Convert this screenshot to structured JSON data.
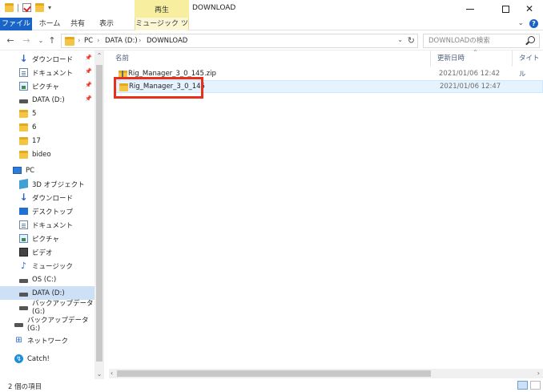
{
  "window": {
    "title": "DOWNLOAD",
    "contextual_group": "再生",
    "controls": {
      "minimize": "",
      "maximize": "",
      "close": "✕"
    }
  },
  "qat": {
    "dropdown": "▾"
  },
  "ribbon": {
    "tabs": [
      {
        "label": "ファイル"
      },
      {
        "label": "ホーム"
      },
      {
        "label": "共有"
      },
      {
        "label": "表示"
      },
      {
        "label": "ミュージック ツール"
      }
    ],
    "expand": "⌄",
    "help": "?"
  },
  "nav": {
    "back": "←",
    "forward": "→",
    "recent": "⌄",
    "up": "↑",
    "breadcrumb": [
      "PC",
      "DATA (D:)",
      "DOWNLOAD"
    ],
    "separator": "›",
    "dropdown": "⌄",
    "refresh": "↻"
  },
  "search": {
    "placeholder": "DOWNLOADの検索"
  },
  "sidebar": {
    "items": [
      {
        "label": "ダウンロード",
        "icon": "download-icon",
        "pinned": true
      },
      {
        "label": "ドキュメント",
        "icon": "document-icon",
        "pinned": true
      },
      {
        "label": "ピクチャ",
        "icon": "pictures-icon",
        "pinned": true
      },
      {
        "label": "DATA (D:)",
        "icon": "drive-icon",
        "pinned": true
      },
      {
        "label": "5",
        "icon": "folder-icon"
      },
      {
        "label": "6",
        "icon": "folder-icon"
      },
      {
        "label": "17",
        "icon": "folder-icon"
      },
      {
        "label": "bideo",
        "icon": "folder-icon"
      },
      {
        "label": "PC",
        "icon": "pc-icon"
      },
      {
        "label": "3D オブジェクト",
        "icon": "3d-objects-icon"
      },
      {
        "label": "ダウンロード",
        "icon": "download-icon"
      },
      {
        "label": "デスクトップ",
        "icon": "desktop-icon"
      },
      {
        "label": "ドキュメント",
        "icon": "document-icon"
      },
      {
        "label": "ピクチャ",
        "icon": "pictures-icon"
      },
      {
        "label": "ビデオ",
        "icon": "video-icon"
      },
      {
        "label": "ミュージック",
        "icon": "music-icon"
      },
      {
        "label": "OS (C:)",
        "icon": "drive-icon"
      },
      {
        "label": "DATA (D:)",
        "icon": "drive-icon",
        "selected": true
      },
      {
        "label": "バックアップデータ (G:)",
        "icon": "drive-icon"
      },
      {
        "label": "バックアップデータ (G:)",
        "icon": "drive-icon"
      },
      {
        "label": "ネットワーク",
        "icon": "network-icon"
      },
      {
        "label": "Catch!",
        "icon": "catch-icon"
      }
    ],
    "pin_glyph": "📌",
    "scroll_up": "⌃",
    "scroll_down": "⌄"
  },
  "columns": [
    {
      "label": "名前"
    },
    {
      "label": "更新日時"
    },
    {
      "label": "タイトル"
    }
  ],
  "sort_indicator": "⌃",
  "files": [
    {
      "name": "Rig_Manager_3_0_145.zip",
      "modified": "2021/01/06 12:42",
      "icon": "zip-folder-icon"
    },
    {
      "name": "Rig_Manager_3_0_145",
      "modified": "2021/01/06 12:47",
      "icon": "folder-icon",
      "selected": true
    }
  ],
  "hscroll": {
    "left": "‹",
    "right": "›"
  },
  "status": {
    "item_count": "2 個の項目"
  },
  "colors": {
    "accent": "#1a64c8",
    "highlight": "#e8301f",
    "contextual": "#f7ef9f",
    "selection": "#cde0f5"
  }
}
